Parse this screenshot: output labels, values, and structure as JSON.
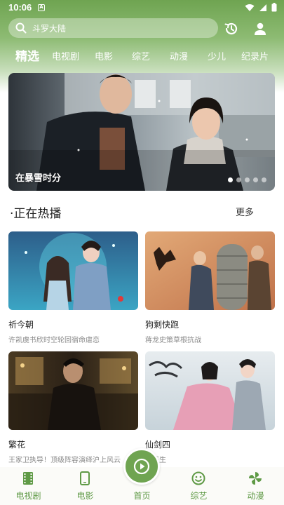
{
  "status_bar": {
    "time": "10:06",
    "a_badge": "A"
  },
  "search": {
    "placeholder": "斗罗大陆"
  },
  "tabs": [
    {
      "label": "精选"
    },
    {
      "label": "电视剧"
    },
    {
      "label": "电影"
    },
    {
      "label": "综艺"
    },
    {
      "label": "动漫"
    },
    {
      "label": "少儿"
    },
    {
      "label": "纪录片"
    }
  ],
  "banner": {
    "title": "在暴雪时分",
    "dot_count": 5,
    "active_dot": 0
  },
  "section": {
    "title": "·正在热播",
    "more": "更多"
  },
  "cards": [
    {
      "title": "祈今朝",
      "desc": "许凯虞书欣时空轮回宿命虐恋"
    },
    {
      "title": "狗剩快跑",
      "desc": "蒋龙史策草根抗战"
    },
    {
      "title": "繁花",
      "desc": "王家卫执导！顶级阵容演绎沪上风云"
    },
    {
      "title": "仙剑四",
      "desc": "护苍生"
    }
  ],
  "bottom_nav": {
    "items": [
      {
        "label": "电视剧"
      },
      {
        "label": "电影"
      },
      {
        "label": "首页"
      },
      {
        "label": "综艺"
      },
      {
        "label": "动漫"
      }
    ]
  },
  "colors": {
    "primary": "#6fa451",
    "nav_text": "#5f9a46"
  }
}
